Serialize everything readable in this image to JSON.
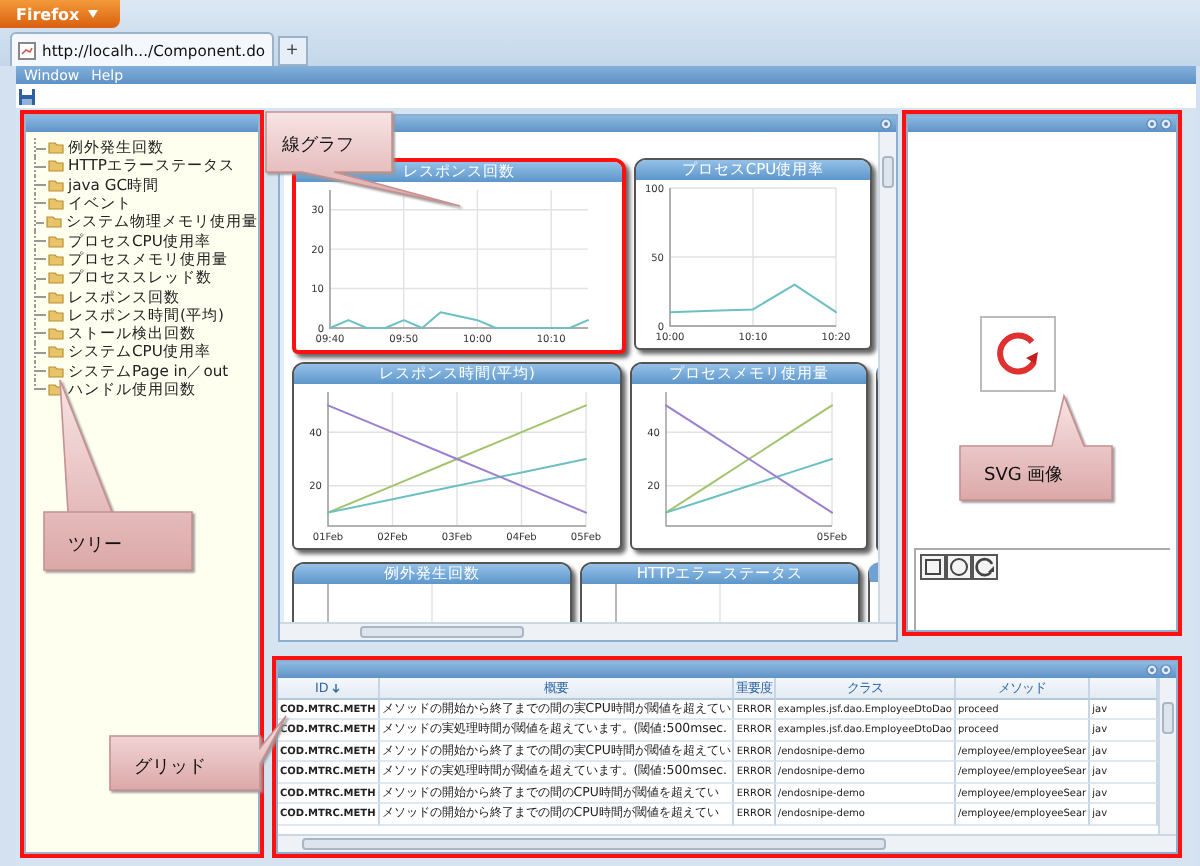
{
  "browser": {
    "menu_button": "Firefox",
    "tab": {
      "title": "http://localh.../Component.do"
    },
    "new_tab": "+"
  },
  "menu": [
    "Window",
    "Help"
  ],
  "tree": {
    "highlighted": true,
    "items": [
      {
        "label": "例外発生回数"
      },
      {
        "label": "HTTPエラーステータス"
      },
      {
        "label": "java GC時間"
      },
      {
        "label": "イベント"
      },
      {
        "label": "システム物理メモリ使用量"
      },
      {
        "label": "プロセスCPU使用率"
      },
      {
        "label": "プロセスメモリ使用量"
      },
      {
        "label": "プロセススレッド数"
      },
      {
        "label": "レスポンス回数"
      },
      {
        "label": "レスポンス時間(平均)"
      },
      {
        "label": "ストール検出回数"
      },
      {
        "label": "システムCPU使用率"
      },
      {
        "label": "システムPage in／out"
      },
      {
        "label": "ハンドル使用回数"
      }
    ]
  },
  "chart_rows": [
    [
      {
        "title": "レスポンス回数",
        "highlighted": true,
        "chart_data": {
          "type": "line",
          "categories": [
            "09:40",
            null,
            null,
            null,
            "09:50",
            null,
            null,
            null,
            "10:00",
            null,
            null,
            null,
            "10:10",
            null,
            null
          ],
          "values": [
            0,
            2,
            0,
            0,
            2,
            0,
            4,
            3,
            2,
            0,
            0,
            0,
            0,
            0,
            2
          ],
          "grid": true,
          "ylim": [
            0,
            35
          ],
          "yticks": [
            0,
            10,
            20,
            30
          ]
        }
      },
      {
        "title": "プロセスCPU使用率",
        "highlighted": false,
        "chart_data": {
          "type": "line",
          "categories": [
            "10:00",
            null,
            "10:10",
            null,
            "10:20"
          ],
          "values": [
            10,
            11,
            12,
            30,
            10
          ],
          "grid": true,
          "ylim": [
            0,
            100
          ],
          "yticks": [
            0,
            50,
            100
          ]
        }
      }
    ],
    [
      {
        "title": "レスポンス時間(平均)",
        "highlighted": false,
        "chart_data": {
          "type": "line",
          "categories": [
            "01Feb",
            "02Feb",
            "03Feb",
            "04Feb",
            "05Feb"
          ],
          "series": [
            {
              "color": "#a3c46c",
              "values": [
                10,
                20,
                30,
                40,
                50
              ]
            },
            {
              "color": "#6cc0c4",
              "values": [
                10,
                15,
                20,
                25,
                30
              ]
            },
            {
              "color": "#9b7fd1",
              "values": [
                50,
                40,
                30,
                20,
                10
              ]
            }
          ],
          "grid": true,
          "ylim": [
            5,
            55
          ],
          "yticks": [
            20,
            40
          ]
        }
      },
      {
        "title": "プロセスメモリ使用量",
        "highlighted": false,
        "chart_data": {
          "type": "line",
          "categories": [
            null,
            null,
            null,
            null,
            "05Feb"
          ],
          "series": [
            {
              "color": "#a3c46c",
              "values": [
                10,
                20,
                30,
                40,
                50
              ]
            },
            {
              "color": "#6cc0c4",
              "values": [
                10,
                15,
                20,
                25,
                30
              ]
            },
            {
              "color": "#9b7fd1",
              "values": [
                50,
                40,
                30,
                20,
                10
              ]
            }
          ],
          "grid": true,
          "ylim": [
            5,
            55
          ],
          "yticks": [
            20,
            40
          ]
        }
      }
    ],
    [
      {
        "title": "例外発生回数",
        "highlighted": false
      },
      {
        "title": "HTTPエラーステータス",
        "highlighted": false
      }
    ]
  ],
  "svg_panel": {
    "highlighted": true
  },
  "grid": {
    "highlighted": true,
    "columns": [
      {
        "label": "ID",
        "sorted": true
      },
      {
        "label": "概要",
        "sorted": false
      },
      {
        "label": "重要度",
        "sorted": false
      },
      {
        "label": "クラス",
        "sorted": false
      },
      {
        "label": "メソッド",
        "sorted": false
      }
    ],
    "rows": [
      [
        "COD.MTRC.METH",
        "メソッドの開始から終了までの間の実CPU時間が閾値を超えてい",
        "ERROR",
        "examples.jsf.dao.EmployeeDtoDao",
        "proceed",
        "jav"
      ],
      [
        "COD.MTRC.METH",
        "メソッドの実処理時間が閾値を超えています。(閾値:500msec.",
        "ERROR",
        "examples.jsf.dao.EmployeeDtoDao",
        "proceed",
        "jav"
      ],
      [
        "COD.MTRC.METH",
        "メソッドの開始から終了までの間の実CPU時間が閾値を超えてい",
        "ERROR",
        "/endosnipe-demo",
        "/employee/employeeSear",
        "jav"
      ],
      [
        "COD.MTRC.METH",
        "メソッドの実処理時間が閾値を超えています。(閾値:500msec.",
        "ERROR",
        "/endosnipe-demo",
        "/employee/employeeSear",
        "jav"
      ],
      [
        "COD.MTRC.METH",
        "メソッドの開始から終了までの間のCPU時間が閾値を超えてい",
        "ERROR",
        "/endosnipe-demo",
        "/employee/employeeSear",
        "jav"
      ],
      [
        "COD.MTRC.METH",
        "メソッドの開始から終了までの間のCPU時間が閾値を超えてい",
        "ERROR",
        "/endosnipe-demo",
        "/employee/employeeSear",
        "jav"
      ]
    ]
  },
  "callouts": [
    {
      "text": "線グラフ"
    },
    {
      "text": "ツリー"
    },
    {
      "text": "SVG 画像"
    },
    {
      "text": "グリッド"
    }
  ]
}
